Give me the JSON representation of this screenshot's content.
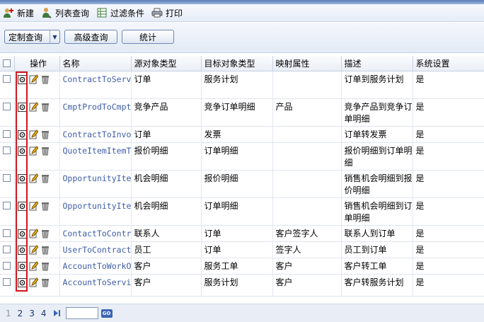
{
  "toolbar": {
    "new_label": "新建",
    "list_query_label": "列表查询",
    "filter_label": "过滤条件",
    "print_label": "打印"
  },
  "actions": {
    "custom_query_label": "定制查询",
    "advanced_query_label": "高级查询",
    "stats_label": "统计"
  },
  "table": {
    "columns": [
      "操作",
      "名称",
      "源对象类型",
      "目标对象类型",
      "映射属性",
      "描述",
      "系统设置"
    ],
    "rows": [
      {
        "name": "ContractToServ",
        "source": "订单",
        "target": "服务计划",
        "mapped": "",
        "desc": "订单到服务计划",
        "system": "是"
      },
      {
        "name": "CmptProdToCmpt",
        "source": "竞争产品",
        "target": "竞争订单明细",
        "mapped": "产品",
        "desc": "竞争产品到竞争订单明细",
        "system": "是"
      },
      {
        "name": "ContractToInvo",
        "source": "订单",
        "target": "发票",
        "mapped": "",
        "desc": "订单转发票",
        "system": "是"
      },
      {
        "name": "QuoteItemItemT",
        "source": "报价明细",
        "target": "订单明细",
        "mapped": "",
        "desc": "报价明细到订单明细",
        "system": "是"
      },
      {
        "name": "OpportunityIte",
        "source": "机会明细",
        "target": "报价明细",
        "mapped": "",
        "desc": "销售机会明细到报价明细",
        "system": "是"
      },
      {
        "name": "OpportunityIte",
        "source": "机会明细",
        "target": "订单明细",
        "mapped": "",
        "desc": "销售机会明细到订单明细",
        "system": "是"
      },
      {
        "name": "ContactToContr",
        "source": "联系人",
        "target": "订单",
        "mapped": "客户签字人",
        "desc": "联系人到订单",
        "system": "是"
      },
      {
        "name": "UserToContract",
        "source": "员工",
        "target": "订单",
        "mapped": "签字人",
        "desc": "员工到订单",
        "system": "是"
      },
      {
        "name": "AccountToWorkO",
        "source": "客户",
        "target": "服务工单",
        "mapped": "客户",
        "desc": "客户转工单",
        "system": "是"
      },
      {
        "name": "AccountToServi",
        "source": "客户",
        "target": "服务计划",
        "mapped": "客户",
        "desc": "客户转服务计划",
        "system": "是"
      }
    ]
  },
  "pager": {
    "pages": [
      "1",
      "2",
      "3",
      "4"
    ],
    "input_value": "",
    "go_label": "GO"
  },
  "colors": {
    "link": "#3d5da8",
    "highlight_box": "#d4131b"
  }
}
